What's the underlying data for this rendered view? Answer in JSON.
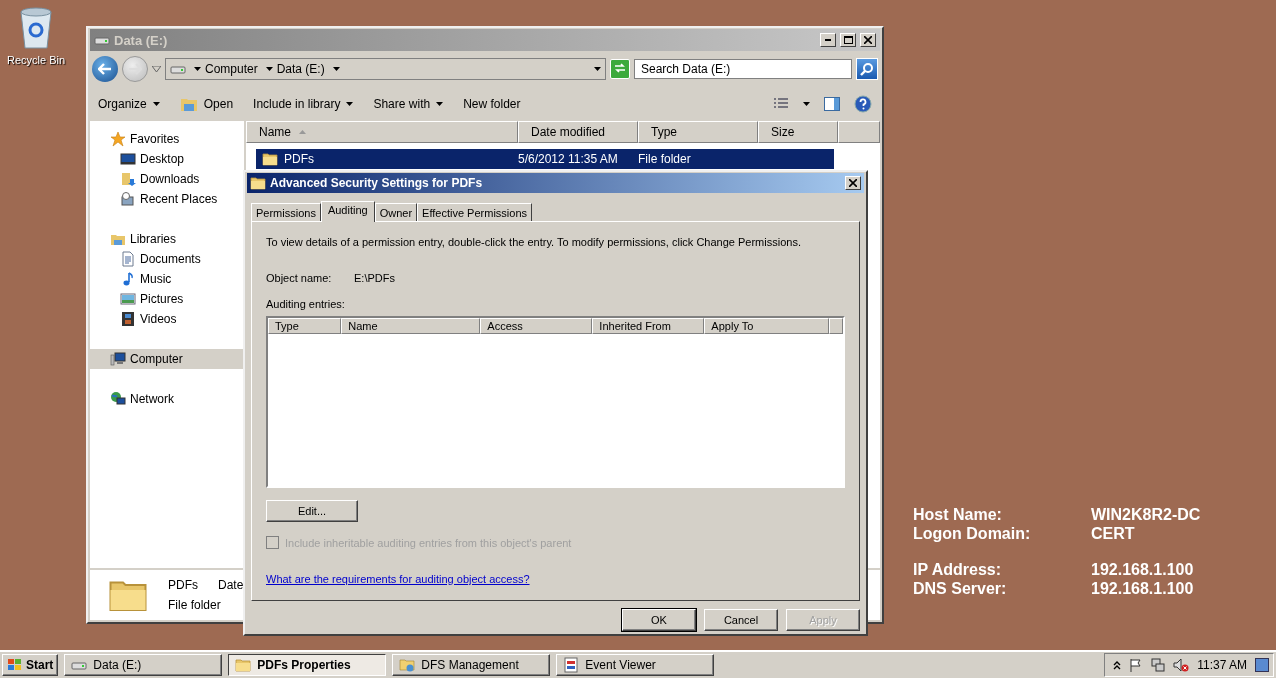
{
  "desktop_icons": [
    {
      "label": "Recycle Bin"
    }
  ],
  "explorer": {
    "title": "Data (E:)",
    "breadcrumb": [
      "Computer",
      "Data (E:)"
    ],
    "search": {
      "placeholder": "Search Data (E:)"
    },
    "toolbar": [
      {
        "label": "Organize",
        "kind": "menu"
      },
      {
        "label": "Open",
        "kind": "icon"
      },
      {
        "label": "Include in library",
        "kind": "menu"
      },
      {
        "label": "Share with",
        "kind": "menu"
      },
      {
        "label": "New folder",
        "kind": "plain"
      }
    ],
    "nav": [
      {
        "label": "Favorites",
        "kind": "star",
        "selected": false,
        "children": [
          {
            "label": "Desktop",
            "kind": "desktop",
            "selected": false
          },
          {
            "label": "Downloads",
            "kind": "downloads",
            "selected": false
          },
          {
            "label": "Recent Places",
            "kind": "recent",
            "selected": false
          }
        ]
      },
      {
        "label": "Libraries",
        "kind": "library",
        "selected": false,
        "children": [
          {
            "label": "Documents",
            "kind": "document",
            "selected": false
          },
          {
            "label": "Music",
            "kind": "music",
            "selected": false
          },
          {
            "label": "Pictures",
            "kind": "pictures",
            "selected": false
          },
          {
            "label": "Videos",
            "kind": "videos",
            "selected": false
          }
        ]
      },
      {
        "label": "Computer",
        "kind": "computer",
        "selected": true
      },
      {
        "label": "Network",
        "kind": "network",
        "selected": false
      }
    ],
    "columns": [
      {
        "label": "Name",
        "sorted": true
      },
      {
        "label": "Date modified",
        "sorted": false
      },
      {
        "label": "Type",
        "sorted": false
      },
      {
        "label": "Size",
        "sorted": false
      }
    ],
    "rows": [
      {
        "name": "PDFs",
        "date": "5/6/2012 11:35 AM",
        "type": "File folder",
        "selected": true
      }
    ],
    "details": {
      "name": "PDFs",
      "date_label": "Date",
      "type": "File folder"
    }
  },
  "dialog": {
    "title": "Advanced Security Settings for PDFs",
    "tabs": [
      {
        "label": "Permissions",
        "selected": false
      },
      {
        "label": "Auditing",
        "selected": true
      },
      {
        "label": "Owner",
        "selected": false
      },
      {
        "label": "Effective Permissions",
        "selected": false
      }
    ],
    "instruction": "To view details of a permission entry, double-click the entry. To modify permissions, click Change Permissions.",
    "object_label": "Object name:",
    "object_value": "E:\\PDFs",
    "entries_label": "Auditing entries:",
    "columns": [
      "Type",
      "Name",
      "Access",
      "Inherited From",
      "Apply To"
    ],
    "edit_button": "Edit...",
    "inherit": {
      "label": "Include inheritable auditing entries from this object's parent",
      "checked": false,
      "disabled": true
    },
    "link": "What are the requirements for auditing object access?",
    "buttons": [
      {
        "label": "OK",
        "default": true,
        "disabled": false
      },
      {
        "label": "Cancel",
        "default": false,
        "disabled": false
      },
      {
        "label": "Apply",
        "default": false,
        "disabled": true
      }
    ]
  },
  "taskbar": {
    "start": "Start",
    "tasks": [
      {
        "label": "Data (E:)",
        "kind": "drive",
        "selected": false
      },
      {
        "label": "PDFs Properties",
        "kind": "folder",
        "selected": true
      },
      {
        "label": "DFS Management",
        "kind": "dfs",
        "selected": false
      },
      {
        "label": "Event Viewer",
        "kind": "viewer",
        "selected": false
      }
    ],
    "clock": "11:37 AM"
  },
  "host_info": [
    {
      "rows": [
        {
          "label": "Host Name:",
          "value": "WIN2K8R2-DC"
        },
        {
          "label": "Logon Domain:",
          "value": "CERT"
        }
      ]
    },
    {
      "rows": [
        {
          "label": "IP Address:",
          "value": "192.168.1.100"
        },
        {
          "label": "DNS Server:",
          "value": "192.168.1.100"
        }
      ]
    }
  ]
}
